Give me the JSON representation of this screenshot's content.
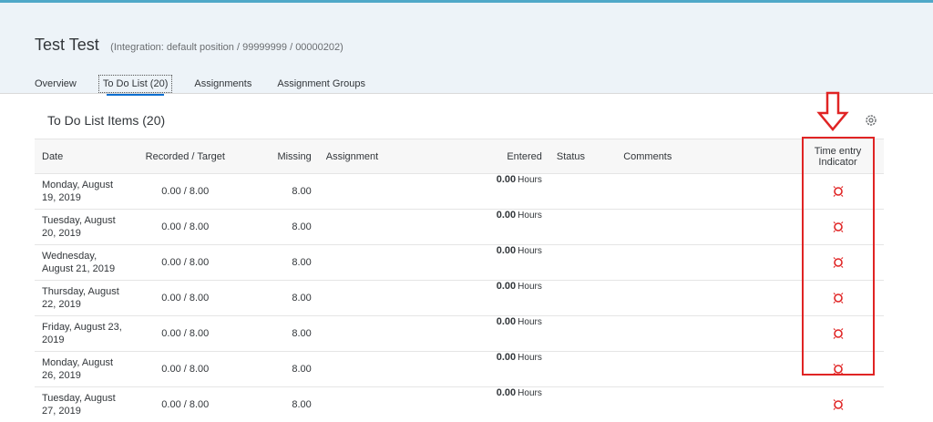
{
  "header": {
    "name": "Test Test",
    "subtitle": "(Integration: default position / 99999999 / 00000202)"
  },
  "tabs": [
    {
      "label": "Overview"
    },
    {
      "label": "To Do List (20)"
    },
    {
      "label": "Assignments"
    },
    {
      "label": "Assignment Groups"
    }
  ],
  "section": {
    "title": "To Do List Items (20)"
  },
  "columns": {
    "date": "Date",
    "recorded": "Recorded / Target",
    "missing": "Missing",
    "assignment": "Assignment",
    "entered": "Entered",
    "status": "Status",
    "comments": "Comments",
    "indicator": "Time entry Indicator"
  },
  "rows": [
    {
      "date": "Monday, August 19, 2019",
      "recorded": "0.00 / 8.00",
      "missing": "8.00",
      "entered": "0.00",
      "unit": "Hours",
      "indicator": "error-icon"
    },
    {
      "date": "Tuesday, August 20, 2019",
      "recorded": "0.00 / 8.00",
      "missing": "8.00",
      "entered": "0.00",
      "unit": "Hours",
      "indicator": "error-icon"
    },
    {
      "date": "Wednesday, August 21, 2019",
      "recorded": "0.00 / 8.00",
      "missing": "8.00",
      "entered": "0.00",
      "unit": "Hours",
      "indicator": "error-icon"
    },
    {
      "date": "Thursday, August 22, 2019",
      "recorded": "0.00 / 8.00",
      "missing": "8.00",
      "entered": "0.00",
      "unit": "Hours",
      "indicator": "error-icon"
    },
    {
      "date": "Friday, August 23, 2019",
      "recorded": "0.00 / 8.00",
      "missing": "8.00",
      "entered": "0.00",
      "unit": "Hours",
      "indicator": "error-icon"
    },
    {
      "date": "Monday, August 26, 2019",
      "recorded": "0.00 / 8.00",
      "missing": "8.00",
      "entered": "0.00",
      "unit": "Hours",
      "indicator": "error-icon"
    },
    {
      "date": "Tuesday, August 27, 2019",
      "recorded": "0.00 / 8.00",
      "missing": "8.00",
      "entered": "0.00",
      "unit": "Hours",
      "indicator": "error-icon"
    }
  ],
  "colors": {
    "accent": "#0a6ed1",
    "error": "#e02424",
    "header_bg": "#edf3f8"
  }
}
